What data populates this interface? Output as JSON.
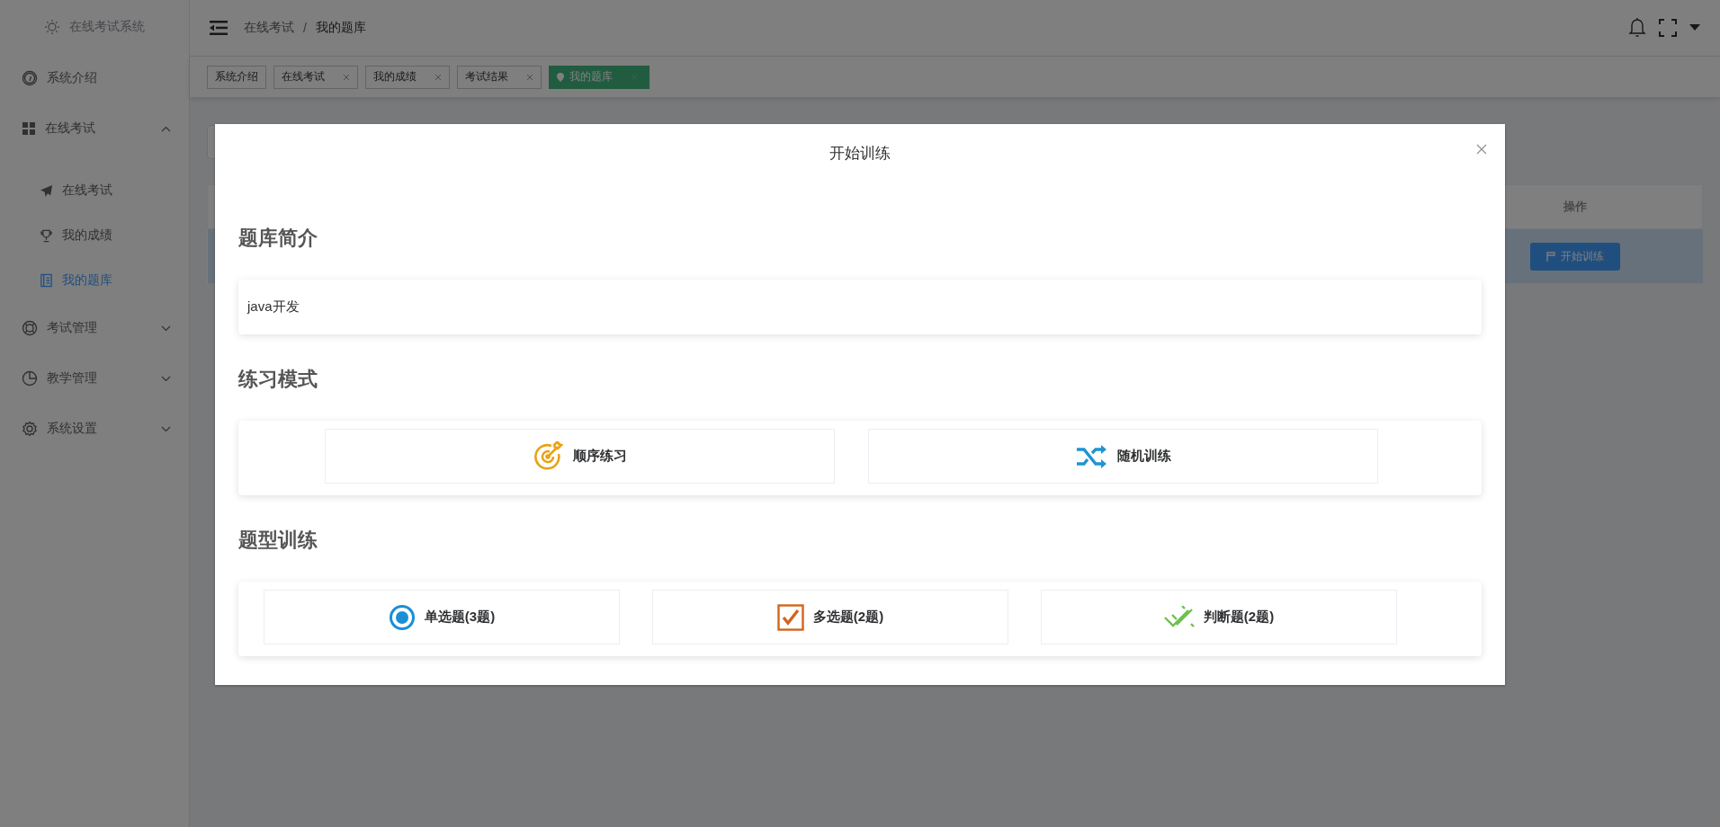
{
  "sidebar": {
    "logo": "在线考试系统",
    "items": [
      {
        "label": "系统介绍",
        "selected": false
      },
      {
        "label": "在线考试",
        "selected": false,
        "expanded": true,
        "children": [
          {
            "label": "在线考试",
            "selected": false
          },
          {
            "label": "我的成绩",
            "selected": false
          },
          {
            "label": "我的题库",
            "selected": true
          }
        ]
      },
      {
        "label": "考试管理",
        "selected": false,
        "expanded": false
      },
      {
        "label": "教学管理",
        "selected": false,
        "expanded": false
      },
      {
        "label": "系统设置",
        "selected": false,
        "expanded": false
      }
    ]
  },
  "header": {
    "breadcrumb": [
      "在线考试",
      "我的题库"
    ],
    "separator": "/"
  },
  "tags": [
    {
      "label": "系统介绍",
      "closable": false,
      "selected": false
    },
    {
      "label": "在线考试",
      "closable": true,
      "selected": false
    },
    {
      "label": "我的成绩",
      "closable": true,
      "selected": false
    },
    {
      "label": "考试结果",
      "closable": true,
      "selected": false
    },
    {
      "label": "我的题库",
      "closable": true,
      "selected": true
    }
  ],
  "table": {
    "columns": [
      "操作"
    ],
    "rows": [
      {
        "action": "开始训练",
        "selected": true
      }
    ]
  },
  "dialog": {
    "title": "开始训练",
    "sections": [
      {
        "heading": "题库简介",
        "kind": "text",
        "text": "java开发"
      },
      {
        "heading": "练习模式",
        "kind": "modes",
        "options": [
          "顺序练习",
          "随机训练"
        ]
      },
      {
        "heading": "题型训练",
        "kind": "types",
        "options": [
          "单选题(3题)",
          "多选题(2题)",
          "判断题(2题)"
        ]
      }
    ]
  }
}
